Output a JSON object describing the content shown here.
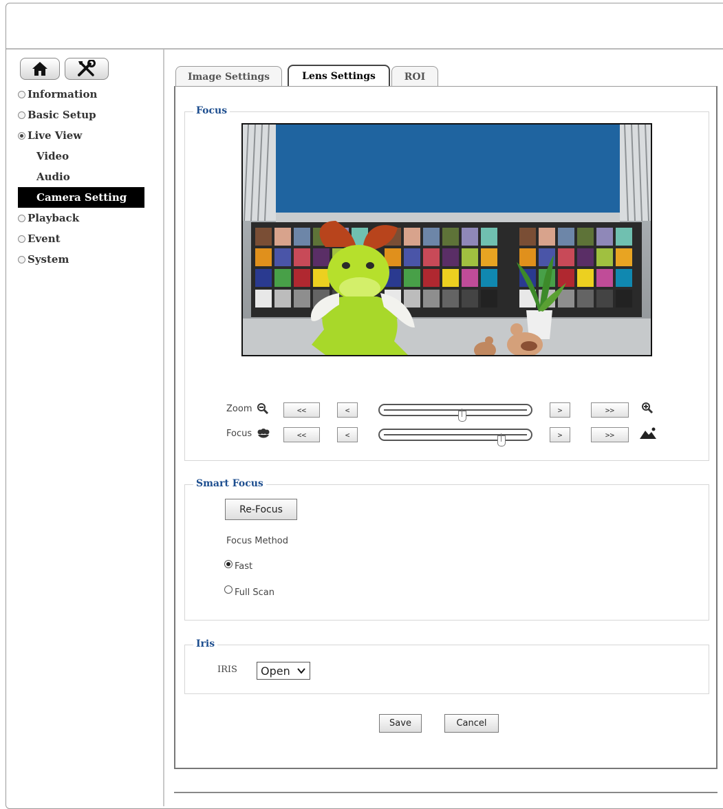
{
  "nav": {
    "home_icon": "home-icon",
    "tools_icon": "tools-icon"
  },
  "sidebar": {
    "items": [
      {
        "label": "Information",
        "selected": false
      },
      {
        "label": "Basic Setup",
        "selected": false
      },
      {
        "label": "Live View",
        "selected": true
      },
      {
        "label": "Playback",
        "selected": false
      },
      {
        "label": "Event",
        "selected": false
      },
      {
        "label": "System",
        "selected": false
      }
    ],
    "sub_items": [
      {
        "label": "Video",
        "active": false
      },
      {
        "label": "Audio",
        "active": false
      },
      {
        "label": "Camera Setting",
        "active": true
      }
    ]
  },
  "tabs": [
    {
      "label": "Image Settings",
      "active": false
    },
    {
      "label": "Lens Settings",
      "active": true
    },
    {
      "label": "ROI",
      "active": false
    }
  ],
  "focus_section": {
    "legend": "Focus",
    "zoom": {
      "label": "Zoom",
      "btn_far_left": "<<",
      "btn_left": "<",
      "btn_right": ">",
      "btn_far_right": ">>",
      "position": 0.55
    },
    "focus": {
      "label": "Focus",
      "btn_far_left": "<<",
      "btn_left": "<",
      "btn_right": ">",
      "btn_far_right": ">>",
      "position": 0.82
    }
  },
  "smart_focus": {
    "legend": "Smart Focus",
    "refocus_label": "Re-Focus",
    "method_label": "Focus Method",
    "options": [
      {
        "label": "Fast",
        "selected": true
      },
      {
        "label": "Full Scan",
        "selected": false
      }
    ]
  },
  "iris": {
    "legend": "Iris",
    "label": "IRIS",
    "selected": "Open"
  },
  "actions": {
    "save": "Save",
    "cancel": "Cancel"
  },
  "colors": {
    "legend_blue": "#1d4e8f",
    "active_menu_bg": "#000000"
  }
}
